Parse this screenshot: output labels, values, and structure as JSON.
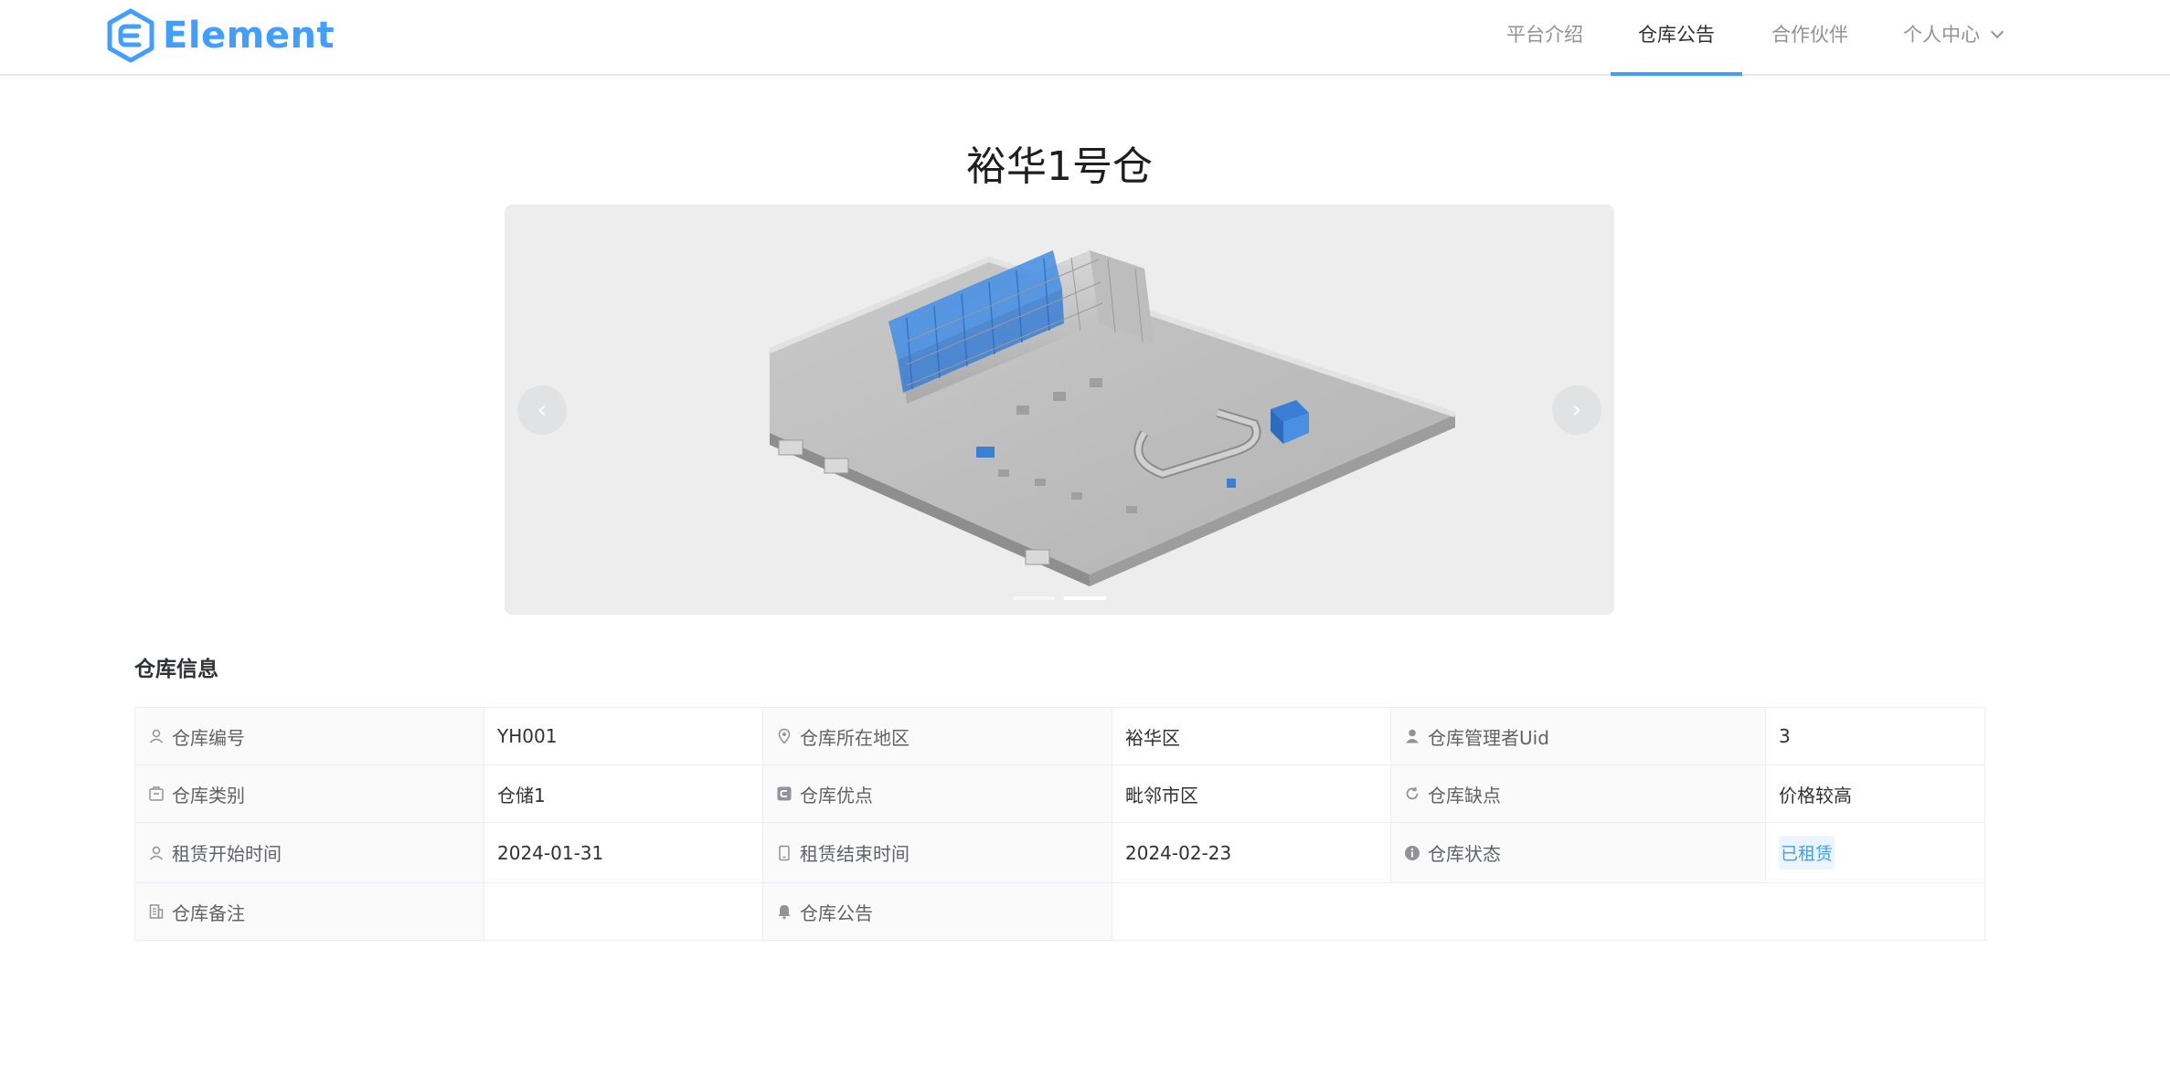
{
  "header": {
    "logo_text": "Element",
    "nav": [
      {
        "label": "平台介绍"
      },
      {
        "label": "仓库公告"
      },
      {
        "label": "合作伙伴"
      },
      {
        "label": "个人中心"
      }
    ],
    "active_nav": "仓库公告"
  },
  "page_title": "裕华1号仓",
  "carousel": {
    "slides": 2,
    "active_index": 1,
    "prev_icon": "chevron-left-icon",
    "next_icon": "chevron-right-icon"
  },
  "section_title": "仓库信息",
  "info": {
    "warehouse_no_label": "仓库编号",
    "warehouse_no": "YH001",
    "region_label": "仓库所在地区",
    "region": "裕华区",
    "manager_uid_label": "仓库管理者Uid",
    "manager_uid": "3",
    "category_label": "仓库类别",
    "category": "仓储1",
    "advantage_label": "仓库优点",
    "advantage": "毗邻市区",
    "disadvantage_label": "仓库缺点",
    "disadvantage": "价格较高",
    "lease_start_label": "租赁开始时间",
    "lease_start": "2024-01-31",
    "lease_end_label": "租赁结束时间",
    "lease_end": "2024-02-23",
    "status_label": "仓库状态",
    "status": "已租赁",
    "remark_label": "仓库备注",
    "remark": "",
    "notice_label": "仓库公告",
    "notice": ""
  },
  "colors": {
    "accent": "#409eff",
    "tag_bg": "#ecf5ff",
    "label_bg": "#fafafa",
    "border": "#ebeef5"
  }
}
